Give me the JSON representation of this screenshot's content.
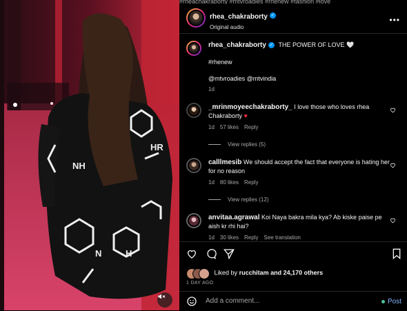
{
  "top_strip_text": "#rheachakraborty #mtvroadies #rhenew #fashion #love",
  "post": {
    "username": "rhea_chakraborty",
    "audio": "Original audio",
    "caption": "THE POWER OF LOVE",
    "heart_emoji": "🤍",
    "hashtag": "#rhenew",
    "mentions": "@mtvroadies @mtvindia",
    "time": "1d"
  },
  "comments": [
    {
      "username": "_mrinmoyeechakraborty_",
      "text": "I love those who loves rhea Chakraborty",
      "emoji": "♥",
      "time": "1d",
      "likes": "57 likes",
      "reply": "Reply",
      "view_replies": "View replies (5)"
    },
    {
      "username": "calllmesib",
      "text": "We should accept the fact that everyone is hating her for no reason",
      "time": "1d",
      "likes": "80 likes",
      "reply": "Reply",
      "view_replies": "View replies (12)"
    },
    {
      "username": "anvitaa.agrawal",
      "text": "Koi Naya bakra mila kya? Ab kiske paise pe aish kr rhi hai?",
      "time": "1d",
      "likes": "30 likes",
      "reply": "Reply",
      "see_translation": "See translation"
    }
  ],
  "engagement": {
    "liked_by": "Liked by",
    "liker": "rucchitam",
    "and_others": "and 24,170 others",
    "ago": "1 DAY AGO"
  },
  "add_comment": {
    "placeholder": "Add a comment...",
    "post_label": "Post"
  },
  "colors": {
    "verified": "#0095f6",
    "link": "#85b6ff",
    "heart_red": "#ff3040"
  }
}
